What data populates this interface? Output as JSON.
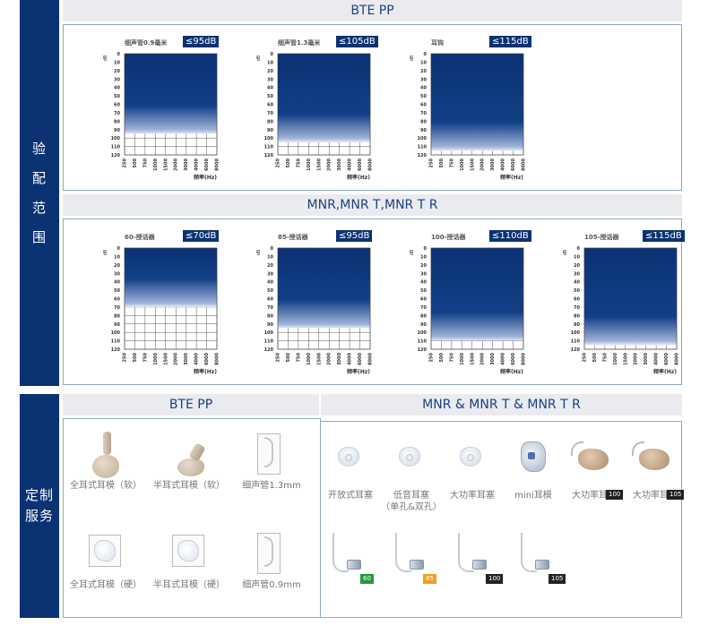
{
  "side": {
    "fitting": [
      "验",
      "配",
      "范",
      "围"
    ],
    "service": [
      "定制",
      "服务"
    ]
  },
  "bands": {
    "bte_pp": "BTE PP",
    "mnr": "MNR,MNR T,MNR T R",
    "svc_bte": "BTE PP",
    "svc_mnr": "MNR & MNR T & MNR T R"
  },
  "axis": {
    "unit": "dB",
    "y_ticks": [
      "0",
      "10",
      "20",
      "30",
      "40",
      "50",
      "60",
      "70",
      "80",
      "90",
      "100",
      "110",
      "120"
    ],
    "x_ticks": [
      "250",
      "500",
      "750",
      "1000",
      "1500",
      "2000",
      "3000",
      "4000",
      "6000",
      "8000"
    ],
    "x_label": "频率(Hz)"
  },
  "colors": {
    "brand": "#0b3273",
    "frame": "#8fa7c9",
    "tag60": "#1f9a3a",
    "tag85": "#f0a020",
    "tag_dark": "#222222"
  },
  "fitting_bte": [
    {
      "title": "细声管0.9毫米",
      "badge": "≤95dB",
      "level": 95
    },
    {
      "title": "细声管1.3毫米",
      "badge": "≤105dB",
      "level": 105
    },
    {
      "title": "耳钩",
      "badge": "≤115dB",
      "level": 115
    }
  ],
  "fitting_mnr": [
    {
      "title": "60-授话器",
      "badge": "≤70dB",
      "level": 70
    },
    {
      "title": "85-授话器",
      "badge": "≤95dB",
      "level": 95
    },
    {
      "title": "100-授话器",
      "badge": "≤110dB",
      "level": 110
    },
    {
      "title": "105-授话器",
      "badge": "≤115dB",
      "level": 115
    }
  ],
  "services": {
    "bte_row1": [
      {
        "name": "ear-mold-full-soft",
        "label": "全耳式耳模（软）"
      },
      {
        "name": "ear-mold-half-soft",
        "label": "半耳式耳模（软）"
      },
      {
        "name": "slim-tube-13",
        "label": "细声管1.3mm"
      }
    ],
    "bte_row2": [
      {
        "name": "ear-mold-full-hard",
        "label": "全耳式耳模（硬）"
      },
      {
        "name": "ear-mold-half-hard",
        "label": "半耳式耳模（硬）"
      },
      {
        "name": "slim-tube-09",
        "label": "细声管0.9mm"
      }
    ],
    "mnr_row1": [
      {
        "name": "open-dome",
        "label": "开放式耳塞",
        "label2": ""
      },
      {
        "name": "closed-dome",
        "label": "低音耳塞",
        "label2": "（单孔&双孔）"
      },
      {
        "name": "power-dome",
        "label": "大功率耳塞",
        "label2": ""
      },
      {
        "name": "mini-mold",
        "label": "mini耳模",
        "label2": ""
      },
      {
        "name": "power-mold-100",
        "label": "大功率耳模",
        "label2": "",
        "tag": "100"
      },
      {
        "name": "power-mold-105",
        "label": "大功率耳模",
        "label2": "",
        "tag": "105"
      }
    ],
    "mnr_row2": [
      {
        "name": "receiver-60",
        "tag": "60"
      },
      {
        "name": "receiver-85",
        "tag": "85"
      },
      {
        "name": "receiver-100",
        "tag": "100"
      },
      {
        "name": "receiver-105",
        "tag": "105"
      }
    ]
  }
}
